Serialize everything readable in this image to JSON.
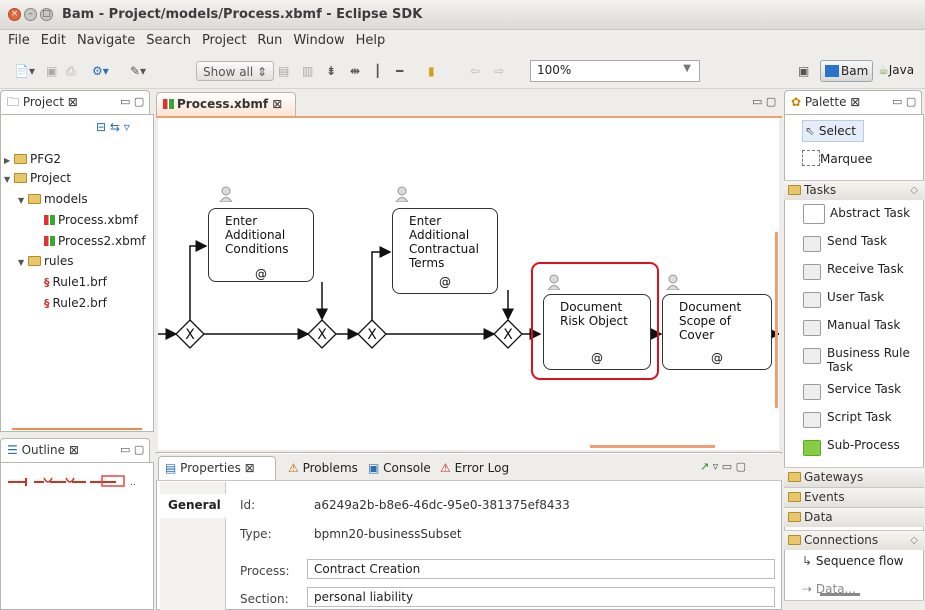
{
  "window": {
    "title": "Bam - Project/models/Process.xbmf - Eclipse SDK",
    "close": "×",
    "min": "–",
    "max": "□"
  },
  "menu": [
    "File",
    "Edit",
    "Navigate",
    "Search",
    "Project",
    "Run",
    "Window",
    "Help"
  ],
  "toolbar": {
    "show_all": "Show all",
    "zoom": "100%",
    "persp_bam": "Bam",
    "persp_java": "Java"
  },
  "project_view": {
    "tab": "Project",
    "items": [
      {
        "label": "PFG2",
        "type": "folder",
        "arrow": "▶"
      },
      {
        "label": "Project",
        "type": "folder",
        "arrow": "▼"
      },
      {
        "label": "models",
        "type": "folder",
        "arrow": "▼"
      },
      {
        "label": "Process.xbmf",
        "type": "bpmn"
      },
      {
        "label": "Process2.xbmf",
        "type": "bpmn"
      },
      {
        "label": "rules",
        "type": "folder",
        "arrow": "▼"
      },
      {
        "label": "Rule1.brf",
        "type": "brf"
      },
      {
        "label": "Rule2.brf",
        "type": "brf"
      }
    ]
  },
  "outline_view": {
    "tab": "Outline"
  },
  "editor": {
    "tab": "Process.xbmf",
    "tasks": [
      {
        "label": "Enter\nAdditional\nConditions",
        "marker": "@"
      },
      {
        "label": "Enter\nAdditional\nContractual\nTerms",
        "marker": "@"
      },
      {
        "label": "Document\nRisk Object",
        "marker": "@"
      },
      {
        "label": "Document\nScope of\nCover",
        "marker": "@"
      }
    ]
  },
  "properties": {
    "tabs": [
      "Properties",
      "Problems",
      "Console",
      "Error Log"
    ],
    "section_tab": "General",
    "rows": [
      {
        "key": "Id:",
        "value": "a6249a2b-b8e6-46dc-95e0-381375ef8433"
      },
      {
        "key": "Type:",
        "value": "bpmn20-businessSubset"
      },
      {
        "key": "Process:",
        "value": "Contract Creation"
      },
      {
        "key": "Section:",
        "value": "personal liability"
      }
    ]
  },
  "palette": {
    "tab": "Palette",
    "tools": [
      "Select",
      "Marquee"
    ],
    "tasks_header": "Tasks",
    "tasks": [
      "Abstract Task",
      "Send Task",
      "Receive Task",
      "User Task",
      "Manual Task",
      "Business Rule Task",
      "Service Task",
      "Script Task",
      "Sub-Process"
    ],
    "drawers": [
      "Gateways",
      "Events",
      "Data"
    ],
    "connections_header": "Connections",
    "connections": [
      "Sequence flow",
      "Data..."
    ]
  }
}
